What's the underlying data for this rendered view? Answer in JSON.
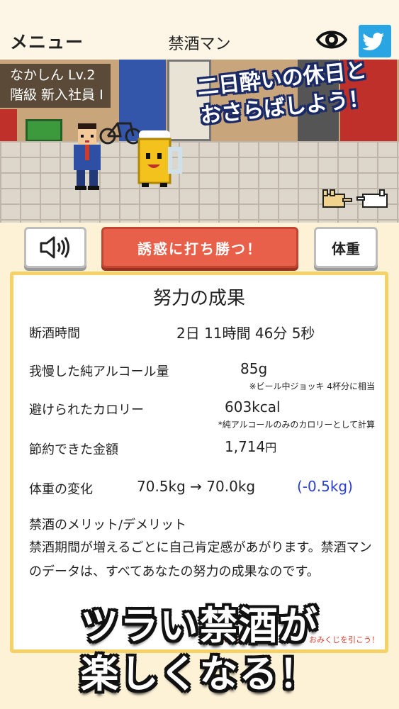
{
  "header": {
    "menu_label": "メニュー",
    "title": "禁酒マン",
    "eye_icon": "eye-icon",
    "twitter_icon": "twitter-bird-icon",
    "twitter_color": "#2aa5e4"
  },
  "scene": {
    "player_name": "なかしん Lv.2",
    "player_rank": "階級 新入社員 I",
    "caption_line1": "二日酔いの休日と",
    "caption_line2": "おさらばしよう！"
  },
  "buttons": {
    "sound_icon": "speaker-icon",
    "tempt_label": "誘惑に打ち勝つ！",
    "weight_label": "体重",
    "tempt_color": "#e8604a"
  },
  "panel": {
    "title": "努力の成果",
    "abstinence_label": "断酒時間",
    "abstinence_value": "2日 11時間 46分 5秒",
    "alcohol_label": "我慢した純アルコール量",
    "alcohol_value": "85g",
    "alcohol_note": "※ビール中ジョッキ 4杯分に相当",
    "calorie_label": "避けられたカロリー",
    "calorie_value": "603kcal",
    "calorie_note": "*純アルコールのみのカロリーとして計算",
    "money_label": "節約できた金額",
    "money_value": "1,714",
    "money_unit": "円",
    "weight_label": "体重の変化",
    "weight_value": "70.5kg → 70.0kg",
    "weight_diff": "(-0.5kg)",
    "weight_diff_color": "#2a3fd0",
    "merit_title": "禁酒のメリット/デメリット",
    "merit_text": "禁酒期間が増えるごとに自己肯定感があがります。禁酒マンのデータは、すべてあなたの努力の成果なのです。",
    "hint": "このパネルをタップして、おみくじを引こう！"
  },
  "promo": {
    "line1": "ツラい禁酒が",
    "line2": "楽しくなる！"
  }
}
